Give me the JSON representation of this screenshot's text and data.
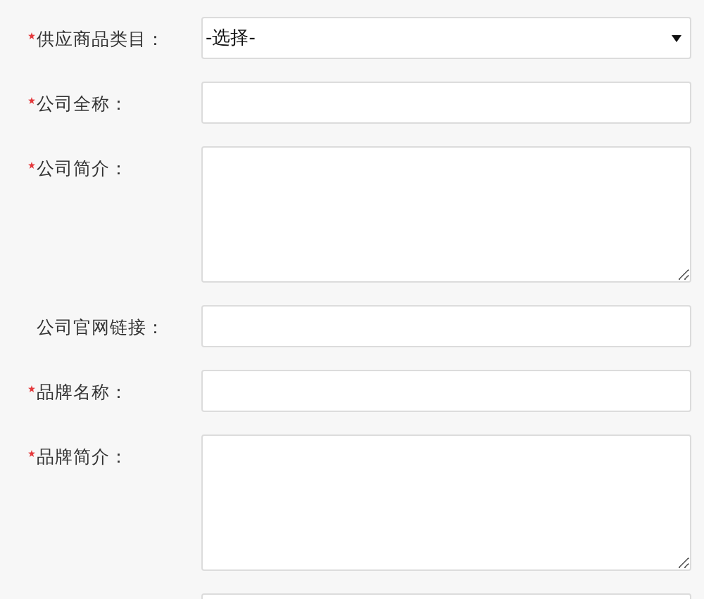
{
  "form": {
    "fields": [
      {
        "label": "供应商品类目：",
        "required": true,
        "kind": "select",
        "value": "-选择-"
      },
      {
        "label": "公司全称：",
        "required": true,
        "kind": "input"
      },
      {
        "label": "公司简介：",
        "required": true,
        "kind": "textarea"
      },
      {
        "label": "公司官网链接：",
        "required": false,
        "kind": "input"
      },
      {
        "label": "品牌名称：",
        "required": true,
        "kind": "input"
      },
      {
        "label": "品牌简介：",
        "required": true,
        "kind": "textarea"
      },
      {
        "kind": "input"
      }
    ]
  }
}
